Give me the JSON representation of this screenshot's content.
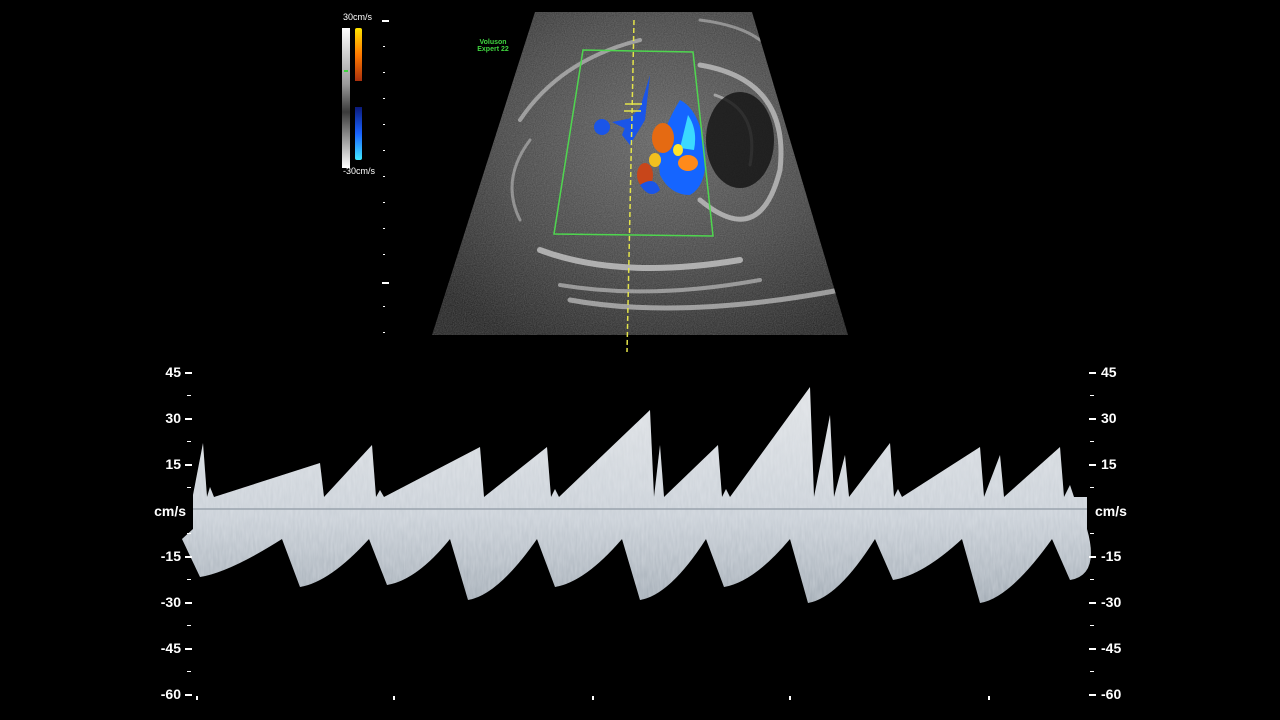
{
  "device": {
    "brand_line_1": "Voluson",
    "brand_line_2": "Expert 22"
  },
  "color_scale": {
    "top_label": "30cm/s",
    "bottom_label": "-30cm/s",
    "positive_colors": [
      "#ffe400",
      "#ff7a00",
      "#c8380f"
    ],
    "negative_colors": [
      "#0b1a7a",
      "#1a63ff",
      "#41e8ff"
    ]
  },
  "colors": {
    "roi_box": "#4fd64f",
    "cursor_line": "#e4e44a",
    "baseline": "#9aa3ad",
    "spectrum": "#e8eef4"
  },
  "spectral_axis": {
    "unit": "cm/s",
    "left_labels": [
      "45",
      "30",
      "15",
      "-15",
      "-30",
      "-45",
      "-60"
    ],
    "right_labels": [
      "45",
      "30",
      "15",
      "-15",
      "-30",
      "-45",
      "-60"
    ]
  }
}
